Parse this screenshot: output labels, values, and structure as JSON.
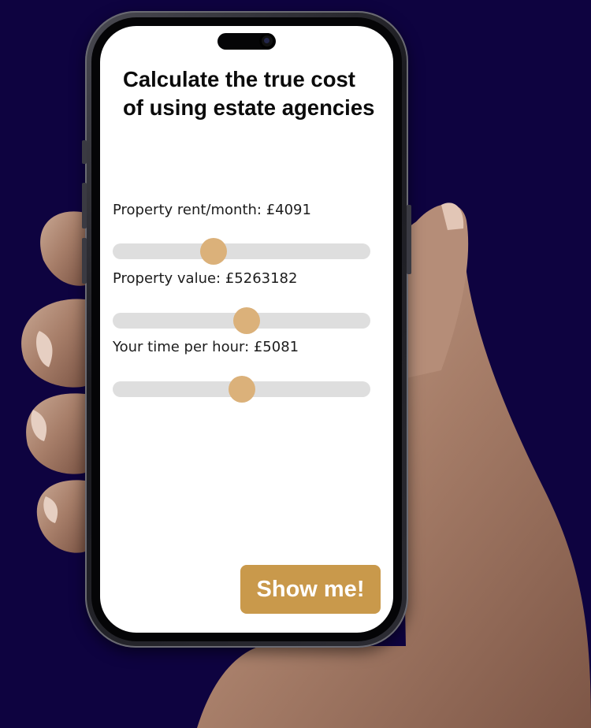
{
  "colors": {
    "background": "#0e0340",
    "slider_thumb": "#dbb17a",
    "slider_track": "#dedede",
    "button": "#c9994b"
  },
  "calculator": {
    "title": "Calculate the true cost of using estate agencies",
    "sliders": [
      {
        "label": "Property rent/month: £4091",
        "level": 0.39
      },
      {
        "label": "Property value: £5263182",
        "level": 0.52
      },
      {
        "label": "Your time per hour: £5081",
        "level": 0.5
      }
    ],
    "show_button": "Show me!"
  }
}
